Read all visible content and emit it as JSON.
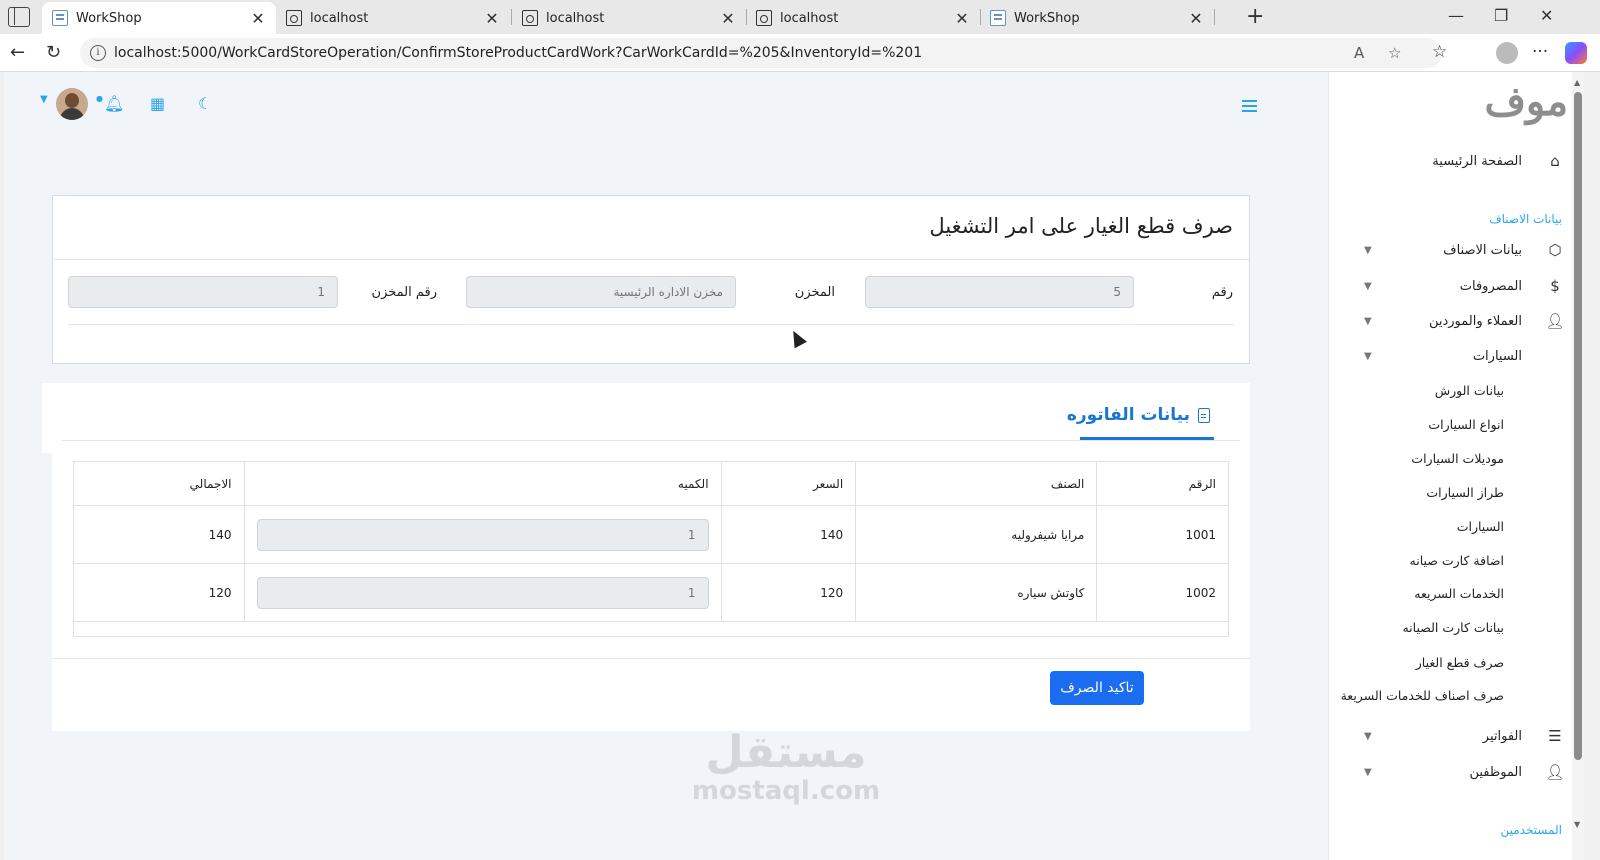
{
  "browser": {
    "tabs": [
      {
        "title": "WorkShop",
        "icon": "page-icon",
        "active": true
      },
      {
        "title": "localhost",
        "icon": "document-icon",
        "active": false
      },
      {
        "title": "localhost",
        "icon": "document-icon",
        "active": false
      },
      {
        "title": "localhost",
        "icon": "document-icon",
        "active": false
      },
      {
        "title": "WorkShop",
        "icon": "page-icon",
        "active": false
      }
    ],
    "url": "localhost:5000/WorkCardStoreOperation/ConfirmStoreProductCardWork?CarWorkCardId=%205&InventoryId=%201"
  },
  "sidebar": {
    "logo": "موف",
    "home": "الصفحة الرئيسية",
    "section_products": "بيانات الاصناف",
    "menu": {
      "products": "بيانات الاصناف",
      "expenses": "المصروفات",
      "clients": "العملاء والموردين",
      "cars": "السيارات",
      "invoices": "الفواتير",
      "employees": "الموظفين"
    },
    "cars_sub": [
      "بيانات الورش",
      "انواع السيارات",
      "موديلات السيارات",
      "طراز السيارات",
      "السيارات",
      "اضافة كارت صيانه",
      "الخدمات السريعه",
      "بيانات كارت الصيانه",
      "صرف قطع الغيار",
      "صرف اصناف للخدمات السريعة"
    ],
    "section_users": "المستخدمين"
  },
  "header": {
    "icons": [
      "hamburger-icon",
      "moon-icon",
      "grid-icon",
      "bell-icon"
    ]
  },
  "form": {
    "title": "صرف قطع الغيار على امر التشغيل",
    "number_label": "رقم",
    "number_value": "5",
    "store_label": "المخزن",
    "store_value": "مخزن الاداره الرئيسية",
    "store_number_label": "رقم المخزن",
    "store_number_value": "1"
  },
  "invoice": {
    "tab_label": "بيانات الفاتوره",
    "columns": [
      "الرقم",
      "الصنف",
      "السعر",
      "الكميه",
      "الاجمالي"
    ],
    "rows": [
      {
        "id": "1001",
        "item": "مرايا شيفروليه",
        "price": "140",
        "qty": "1",
        "total": "140"
      },
      {
        "id": "1002",
        "item": "كاوتش سياره",
        "price": "120",
        "qty": "1",
        "total": "120"
      }
    ],
    "confirm_label": "تاكيد الصرف"
  },
  "watermark": {
    "ar": "مستقل",
    "en": "mostaql.com"
  },
  "colors": {
    "accent": "#2aa5ec",
    "primary": "#1a6cf0",
    "tab_blue": "#1976d2"
  }
}
